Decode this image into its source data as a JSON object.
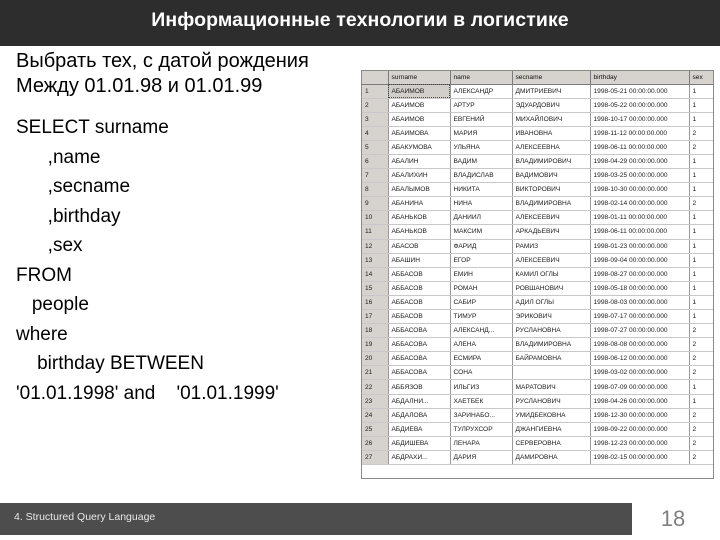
{
  "header": {
    "title": "Информационные технологии в логистике",
    "background_color": "#2e2d2d",
    "text_color": "#ffffff"
  },
  "slide": {
    "prompt": [
      "Выбрать тех, с датой рождения",
      "Между 01.01.98 и 01.01.99"
    ],
    "sql": [
      "SELECT surname",
      "      ,name",
      "      ,secname",
      "      ,birthday",
      "      ,sex",
      "FROM",
      "   people",
      "where",
      "    birthday BETWEEN",
      "'01.01.1998' and    '01.01.1999'"
    ]
  },
  "result_grid": {
    "columns": [
      "",
      "surname",
      "name",
      "secname",
      "birthday",
      "sex"
    ],
    "selected_cell": {
      "row": 1,
      "column": "surname"
    },
    "rows": [
      {
        "n": "1",
        "surname": "АБАИМОВ",
        "name": "АЛЕКСАНДР",
        "secname": "ДМИТРИЕВИЧ",
        "birthday": "1998-05-21 00:00:00.000",
        "sex": "1"
      },
      {
        "n": "2",
        "surname": "АБАИМОВ",
        "name": "АРТУР",
        "secname": "ЭДУАРДОВИЧ",
        "birthday": "1998-05-22 00:00:00.000",
        "sex": "1"
      },
      {
        "n": "3",
        "surname": "АБАИМОВ",
        "name": "ЕВГЕНИЙ",
        "secname": "МИХАЙЛОВИЧ",
        "birthday": "1998-10-17 00:00:00.000",
        "sex": "1"
      },
      {
        "n": "4",
        "surname": "АБАИМОВА",
        "name": "МАРИЯ",
        "secname": "ИВАНОВНА",
        "birthday": "1998-11-12 00:00:00.000",
        "sex": "2"
      },
      {
        "n": "5",
        "surname": "АБАКУМОВА",
        "name": "УЛЬЯНА",
        "secname": "АЛЕКСЕЕВНА",
        "birthday": "1998-06-11 00:00:00.000",
        "sex": "2"
      },
      {
        "n": "6",
        "surname": "АБАЛИН",
        "name": "ВАДИМ",
        "secname": "ВЛАДИМИРОВИЧ",
        "birthday": "1998-04-29 00:00:00.000",
        "sex": "1"
      },
      {
        "n": "7",
        "surname": "АБАЛИХИН",
        "name": "ВЛАДИСЛАВ",
        "secname": "ВАДИМОВИЧ",
        "birthday": "1998-03-25 00:00:00.000",
        "sex": "1"
      },
      {
        "n": "8",
        "surname": "АБАЛЫМОВ",
        "name": "НИКИТА",
        "secname": "ВИКТОРОВИЧ",
        "birthday": "1998-10-30 00:00:00.000",
        "sex": "1"
      },
      {
        "n": "9",
        "surname": "АБАНИНА",
        "name": "НИНА",
        "secname": "ВЛАДИМИРОВНА",
        "birthday": "1998-02-14 00:00:00.000",
        "sex": "2"
      },
      {
        "n": "10",
        "surname": "АБАНЬКОВ",
        "name": "ДАНИИЛ",
        "secname": "АЛЕКСЕЕВИЧ",
        "birthday": "1998-01-11 00:00:00.000",
        "sex": "1"
      },
      {
        "n": "11",
        "surname": "АБАНЬКОВ",
        "name": "МАКСИМ",
        "secname": "АРКАДЬЕВИЧ",
        "birthday": "1998-06-11 00:00:00.000",
        "sex": "1"
      },
      {
        "n": "12",
        "surname": "АБАСОВ",
        "name": "ФАРИД",
        "secname": "РАМИЗ",
        "birthday": "1998-01-23 00:00:00.000",
        "sex": "1"
      },
      {
        "n": "13",
        "surname": "АБАШИН",
        "name": "ЕГОР",
        "secname": "АЛЕКСЕЕВИЧ",
        "birthday": "1998-09-04 00:00:00.000",
        "sex": "1"
      },
      {
        "n": "14",
        "surname": "АББАСОВ",
        "name": "ЕМИН",
        "secname": "КАМИЛ ОГЛЫ",
        "birthday": "1998-08-27 00:00:00.000",
        "sex": "1"
      },
      {
        "n": "15",
        "surname": "АББАСОВ",
        "name": "РОМАН",
        "secname": "РОВШАНОВИЧ",
        "birthday": "1998-05-18 00:00:00.000",
        "sex": "1"
      },
      {
        "n": "16",
        "surname": "АББАСОВ",
        "name": "САБИР",
        "secname": "АДИЛ ОГЛЫ",
        "birthday": "1998-08-03 00:00:00.000",
        "sex": "1"
      },
      {
        "n": "17",
        "surname": "АББАСОВ",
        "name": "ТИМУР",
        "secname": "ЭРИКОВИЧ",
        "birthday": "1998-07-17 00:00:00.000",
        "sex": "1"
      },
      {
        "n": "18",
        "surname": "АББАСОВА",
        "name": "АЛЕКСАНД...",
        "secname": "РУСЛАНОВНА",
        "birthday": "1998-07-27 00:00:00.000",
        "sex": "2"
      },
      {
        "n": "19",
        "surname": "АББАСОВА",
        "name": "АЛЕНА",
        "secname": "ВЛАДИМИРОВНА",
        "birthday": "1998-08-08 00:00:00.000",
        "sex": "2"
      },
      {
        "n": "20",
        "surname": "АББАСОВА",
        "name": "ЕСМИРА",
        "secname": "БАЙРАМОВНА",
        "birthday": "1998-06-12 00:00:00.000",
        "sex": "2"
      },
      {
        "n": "21",
        "surname": "АББАСОВА",
        "name": "СОНА",
        "secname": "",
        "birthday": "1998-03-02 00:00:00.000",
        "sex": "2"
      },
      {
        "n": "22",
        "surname": "АББЯЗОВ",
        "name": "ИЛЬГИЗ",
        "secname": "МАРАТОВИЧ",
        "birthday": "1998-07-09 00:00:00.000",
        "sex": "1"
      },
      {
        "n": "23",
        "surname": "АБДАЛНИ...",
        "name": "ХАЕТБЕК",
        "secname": "РУСЛАНОВИЧ",
        "birthday": "1998-04-26 00:00:00.000",
        "sex": "1"
      },
      {
        "n": "24",
        "surname": "АБДАЛОВА",
        "name": "ЗАРИНАБО...",
        "secname": "УМИДБЕКОВНА",
        "birthday": "1998-12-30 00:00:00.000",
        "sex": "2"
      },
      {
        "n": "25",
        "surname": "АБДИЕВА",
        "name": "ТУЛРУХСОР",
        "secname": "ДЖАНГИЕВНА",
        "birthday": "1998-09-22 00:00:00.000",
        "sex": "2"
      },
      {
        "n": "26",
        "surname": "АБДИШЕВА",
        "name": "ЛЕНАРА",
        "secname": "СЕРВЕРОВНА",
        "birthday": "1998-12-23 00:00:00.000",
        "sex": "2"
      },
      {
        "n": "27",
        "surname": "АБДРАХИ...",
        "name": "ДАРИЯ",
        "secname": "ДАМИРОВНА",
        "birthday": "1998-02-15 00:00:00.000",
        "sex": "2"
      }
    ]
  },
  "footer": {
    "section_label": "4. Structured Query Language",
    "slide_number": "18",
    "background_color": "#4d4d4d"
  }
}
